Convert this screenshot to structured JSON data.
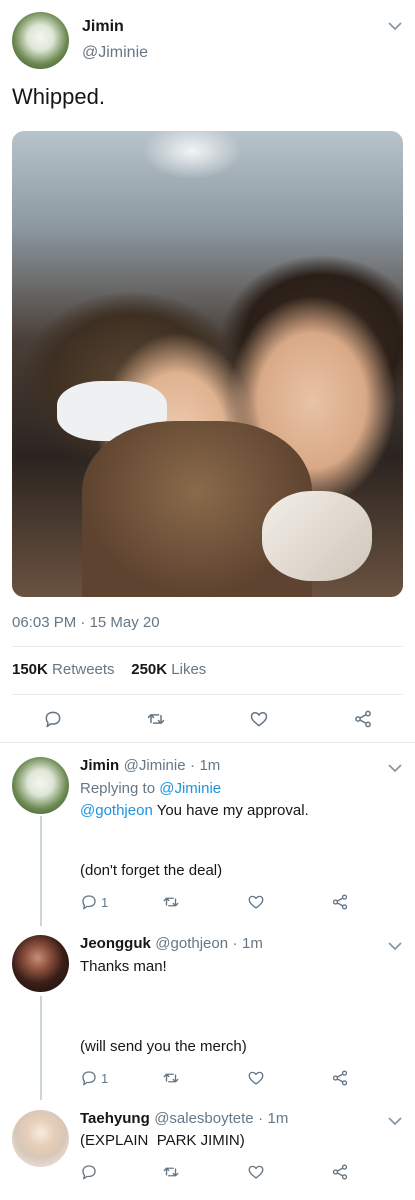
{
  "tweet": {
    "author_name": "Jimin",
    "author_handle": "@Jiminie",
    "text": "Whipped.",
    "time": "06:03 PM",
    "separator": "·",
    "date": "15 May 20",
    "retweets_count": "150K",
    "retweets_label": "Retweets",
    "likes_count": "250K",
    "likes_label": "Likes"
  },
  "replies": [
    {
      "name": "Jimin",
      "handle": "@Jiminie",
      "dot": "·",
      "age": "1m",
      "replying_label": "Replying to",
      "replying_handle": "@Jiminie",
      "mention": "@gothjeon",
      "text": "You have my approval.",
      "text2": "(don't forget the deal)",
      "reply_count": "1"
    },
    {
      "name": "Jeongguk",
      "handle": "@gothjeon",
      "dot": "·",
      "age": "1m",
      "text": "Thanks man!",
      "text2": "(will send you the merch)",
      "reply_count": "1"
    },
    {
      "name": "Taehyung",
      "handle": "@salesboytete",
      "dot": "·",
      "age": "1m",
      "text": "(EXPLAIN  PARK JIMIN)"
    }
  ],
  "icons": [
    "reply-icon",
    "retweet-icon",
    "like-icon",
    "share-icon",
    "chevron-down-icon"
  ],
  "colors": {
    "link": "#1b95e0",
    "muted": "#657786",
    "text": "#14171a",
    "divider": "#e6ecf0"
  }
}
